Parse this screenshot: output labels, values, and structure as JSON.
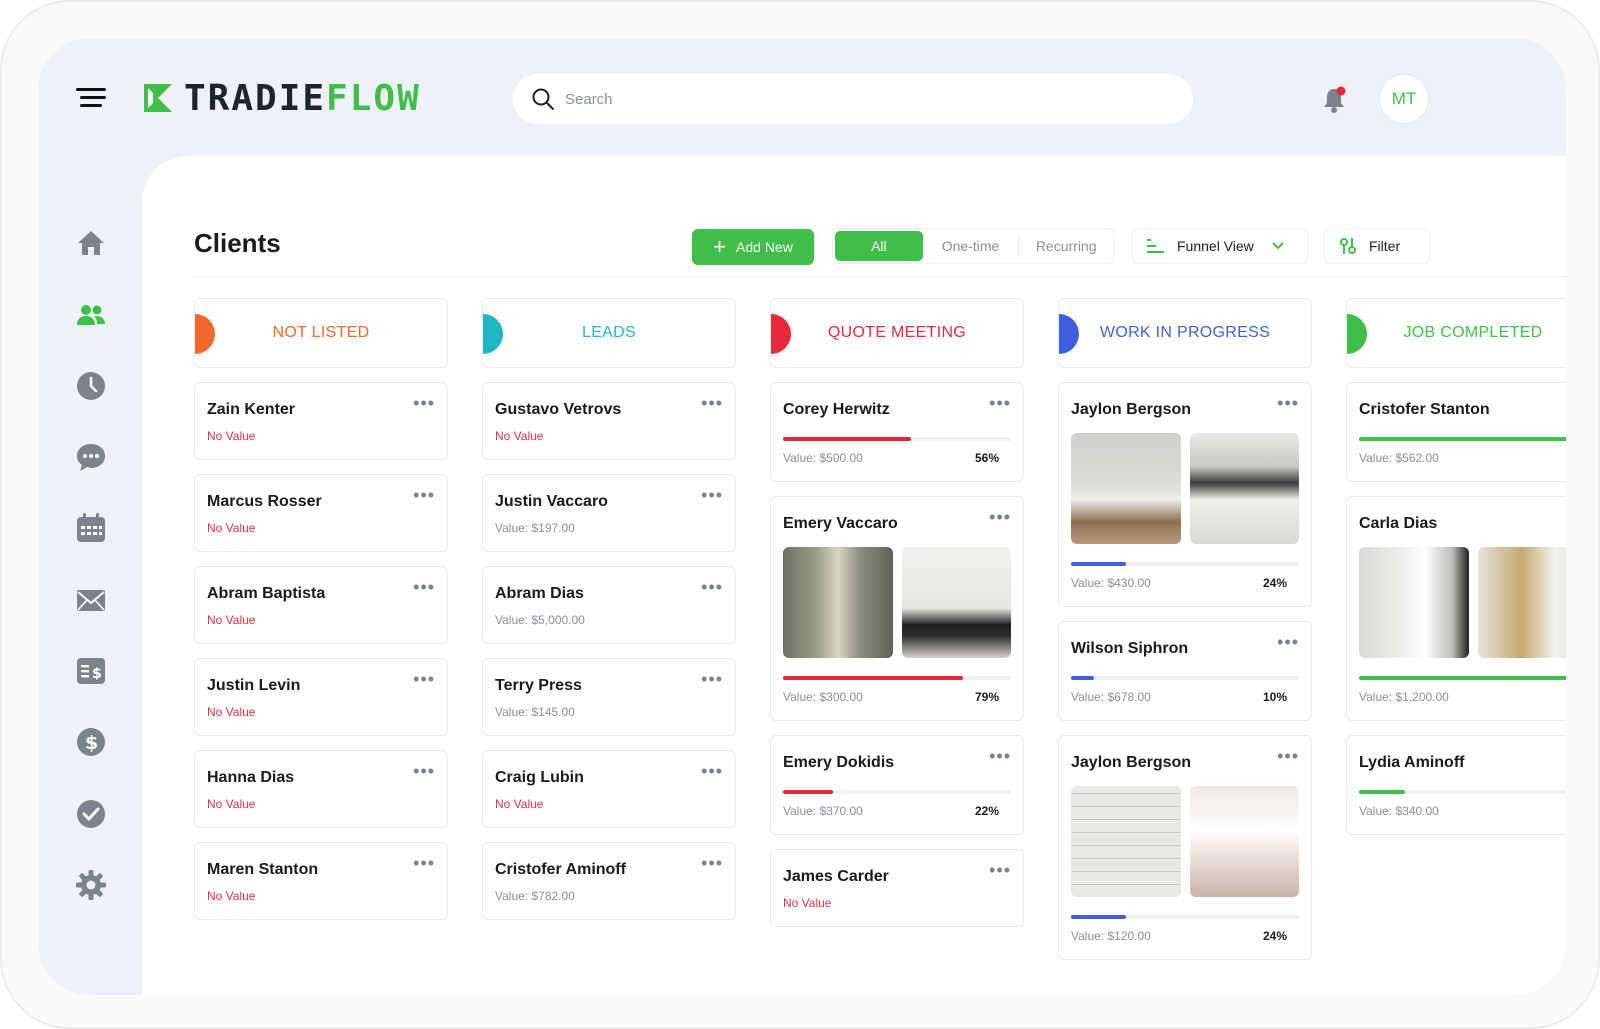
{
  "brand": {
    "word1": "TRADIE",
    "word2": "FLOW",
    "green": "#3fbf4a"
  },
  "search": {
    "placeholder": "Search"
  },
  "user": {
    "initials": "MT"
  },
  "sidebar": [
    "home-icon",
    "users-icon",
    "clock-icon",
    "chat-icon",
    "calendar-icon",
    "mail-icon",
    "invoice-icon",
    "dollar-icon",
    "check-icon",
    "gear-icon"
  ],
  "page": {
    "title": "Clients"
  },
  "toolbar": {
    "add_label": "Add New",
    "segments": [
      "All",
      "One-time",
      "Recurring"
    ],
    "view_label": "Funnel View",
    "filter_label": "Filter"
  },
  "columns": [
    {
      "title": "NOT LISTED",
      "color": "#f2682a",
      "cards": [
        {
          "name": "Zain Kenter",
          "value": "No Value"
        },
        {
          "name": "Marcus Rosser",
          "value": "No Value"
        },
        {
          "name": "Abram Baptista",
          "value": "No Value"
        },
        {
          "name": "Justin Levin",
          "value": "No Value"
        },
        {
          "name": "Hanna Dias",
          "value": "No Value"
        },
        {
          "name": "Maren Stanton",
          "value": "No Value"
        }
      ]
    },
    {
      "title": "LEADS",
      "color": "#21b8c4",
      "cards": [
        {
          "name": "Gustavo Vetrovs",
          "value": "No Value"
        },
        {
          "name": "Justin Vaccaro",
          "value": "Value: $197.00"
        },
        {
          "name": "Abram Dias",
          "value": "Value: $5,000.00"
        },
        {
          "name": "Terry Press",
          "value": "Value: $145.00"
        },
        {
          "name": "Craig Lubin",
          "value": "No Value"
        },
        {
          "name": "Cristofer Aminoff",
          "value": "Value: $782.00"
        }
      ]
    },
    {
      "title": "QUOTE MEETING",
      "color": "#e5283a",
      "cards": [
        {
          "name": "Corey Herwitz",
          "value": "Value: $500.00",
          "percent": "56%",
          "progress": 0.56
        },
        {
          "name": "Emery Vaccaro",
          "value": "Value: $300.00",
          "percent": "79%",
          "progress": 0.79,
          "photos": [
            "hallway-photo",
            "kitchen-photo"
          ]
        },
        {
          "name": "Emery Dokidis",
          "value": "Value: $370.00",
          "percent": "22%",
          "progress": 0.22
        },
        {
          "name": "James Carder",
          "value": "No Value"
        }
      ]
    },
    {
      "title": "WORK IN PROGRESS",
      "color": "#3f5fe0",
      "cards": [
        {
          "name": "Jaylon Bergson",
          "value": "Value: $430.00",
          "percent": "24%",
          "progress": 0.24,
          "photos": [
            "living-room-photo",
            "lounge-photo"
          ]
        },
        {
          "name": "Wilson Siphron",
          "value": "Value: $678.00",
          "percent": "10%",
          "progress": 0.1
        },
        {
          "name": "Jaylon Bergson",
          "value": "Value: $120.00",
          "percent": "24%",
          "progress": 0.24,
          "photos": [
            "tiled-wall-photo",
            "bright-kitchen-photo"
          ]
        }
      ]
    },
    {
      "title": "JOB COMPLETED",
      "color": "#3fbf4a",
      "cards": [
        {
          "name": "Cristofer Stanton",
          "value": "Value: $562.00",
          "progress": 1.0
        },
        {
          "name": "Carla Dias",
          "value": "Value: $1,200.00",
          "progress": 0.95,
          "photos": [
            "bathroom-photo",
            "vanity-photo"
          ]
        },
        {
          "name": "Lydia Aminoff",
          "value": "Value: $340.00",
          "progress": 0.2
        }
      ]
    }
  ]
}
